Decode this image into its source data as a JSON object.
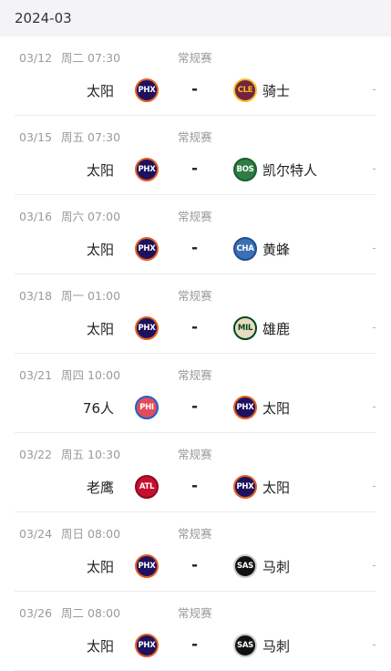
{
  "month_label": "2024-03",
  "team_colors": {
    "phx": "#1d1160",
    "cle": "#6f263d",
    "bos": "#2e7d45",
    "cha": "#3d6fb3",
    "mil": "#e8dcc0",
    "phi": "#e24b5a",
    "atl": "#c8102e",
    "sas": "#111111"
  },
  "games": [
    {
      "date": "03/12",
      "weekday": "周二",
      "time": "07:30",
      "competition": "常规赛",
      "home": {
        "name": "太阳",
        "abbr": "PHX",
        "logo_class": "logo-phx"
      },
      "score": "-",
      "away": {
        "name": "骑士",
        "abbr": "CLE",
        "logo_class": "logo-cle"
      },
      "status": "-"
    },
    {
      "date": "03/15",
      "weekday": "周五",
      "time": "07:30",
      "competition": "常规赛",
      "home": {
        "name": "太阳",
        "abbr": "PHX",
        "logo_class": "logo-phx"
      },
      "score": "-",
      "away": {
        "name": "凯尔特人",
        "abbr": "BOS",
        "logo_class": "logo-bos"
      },
      "status": "-"
    },
    {
      "date": "03/16",
      "weekday": "周六",
      "time": "07:00",
      "competition": "常规赛",
      "home": {
        "name": "太阳",
        "abbr": "PHX",
        "logo_class": "logo-phx"
      },
      "score": "-",
      "away": {
        "name": "黄蜂",
        "abbr": "CHA",
        "logo_class": "logo-cha"
      },
      "status": "-"
    },
    {
      "date": "03/18",
      "weekday": "周一",
      "time": "01:00",
      "competition": "常规赛",
      "home": {
        "name": "太阳",
        "abbr": "PHX",
        "logo_class": "logo-phx"
      },
      "score": "-",
      "away": {
        "name": "雄鹿",
        "abbr": "MIL",
        "logo_class": "logo-mil"
      },
      "status": "-"
    },
    {
      "date": "03/21",
      "weekday": "周四",
      "time": "10:00",
      "competition": "常规赛",
      "home": {
        "name": "76人",
        "abbr": "PHI",
        "logo_class": "logo-phi"
      },
      "score": "-",
      "away": {
        "name": "太阳",
        "abbr": "PHX",
        "logo_class": "logo-phx"
      },
      "status": "-"
    },
    {
      "date": "03/22",
      "weekday": "周五",
      "time": "10:30",
      "competition": "常规赛",
      "home": {
        "name": "老鹰",
        "abbr": "ATL",
        "logo_class": "logo-atl"
      },
      "score": "-",
      "away": {
        "name": "太阳",
        "abbr": "PHX",
        "logo_class": "logo-phx"
      },
      "status": "-"
    },
    {
      "date": "03/24",
      "weekday": "周日",
      "time": "08:00",
      "competition": "常规赛",
      "home": {
        "name": "太阳",
        "abbr": "PHX",
        "logo_class": "logo-phx"
      },
      "score": "-",
      "away": {
        "name": "马刺",
        "abbr": "SAS",
        "logo_class": "logo-sas"
      },
      "status": "-"
    },
    {
      "date": "03/26",
      "weekday": "周二",
      "time": "08:00",
      "competition": "常规赛",
      "home": {
        "name": "太阳",
        "abbr": "PHX",
        "logo_class": "logo-phx"
      },
      "score": "-",
      "away": {
        "name": "马刺",
        "abbr": "SAS",
        "logo_class": "logo-sas"
      },
      "status": "-"
    }
  ]
}
